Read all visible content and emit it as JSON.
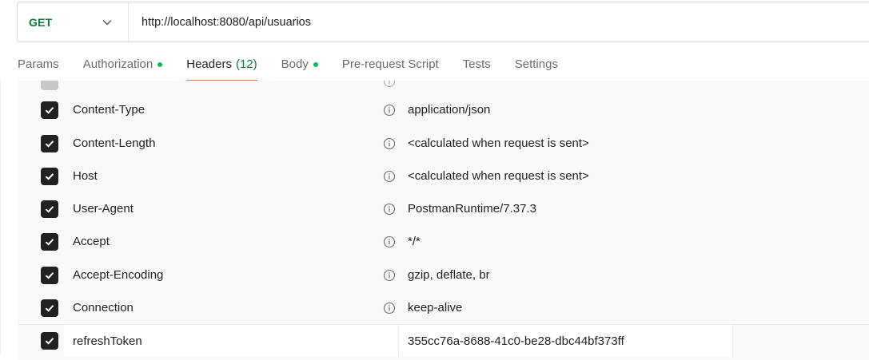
{
  "request": {
    "method": "GET",
    "url": "http://localhost:8080/api/usuarios"
  },
  "tabs": [
    {
      "label": "Params",
      "count": "",
      "dot": false,
      "active": false
    },
    {
      "label": "Authorization",
      "count": "",
      "dot": true,
      "active": false
    },
    {
      "label": "Headers",
      "count": "(12)",
      "dot": false,
      "active": true
    },
    {
      "label": "Body",
      "count": "",
      "dot": true,
      "active": false
    },
    {
      "label": "Pre-request Script",
      "count": "",
      "dot": false,
      "active": false
    },
    {
      "label": "Tests",
      "count": "",
      "dot": false,
      "active": false
    },
    {
      "label": "Settings",
      "count": "",
      "dot": false,
      "active": false
    }
  ],
  "headers": [
    {
      "key": "Content-Type",
      "value": "application/json",
      "checked": true
    },
    {
      "key": "Content-Length",
      "value": "<calculated when request is sent>",
      "checked": true
    },
    {
      "key": "Host",
      "value": "<calculated when request is sent>",
      "checked": true
    },
    {
      "key": "User-Agent",
      "value": "PostmanRuntime/7.37.3",
      "checked": true
    },
    {
      "key": "Accept",
      "value": "*/*",
      "checked": true
    },
    {
      "key": "Accept-Encoding",
      "value": "gzip, deflate, br",
      "checked": true
    },
    {
      "key": "Connection",
      "value": "keep-alive",
      "checked": true
    }
  ],
  "custom_header": {
    "key": "refreshToken",
    "value": "355cc76a-8688-41c0-be28-dbc44bf373ff",
    "checked": true
  },
  "colors": {
    "method_green": "#0b7a38",
    "active_tab_underline": "#ff6c37",
    "dot_green": "#0cbb52",
    "checkbox": "#212121"
  }
}
